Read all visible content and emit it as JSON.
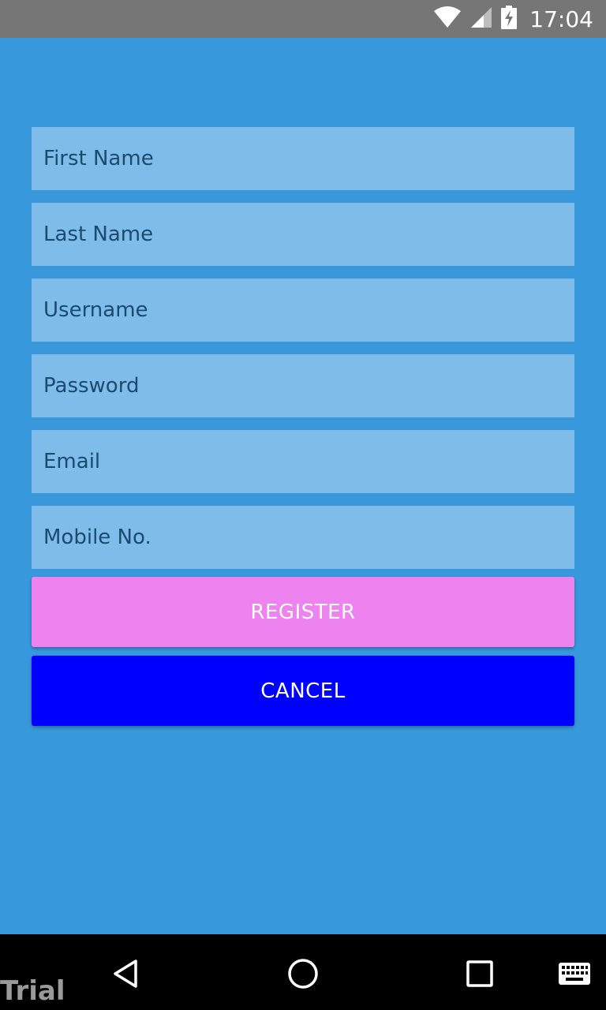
{
  "status_bar": {
    "time": "17:04",
    "icons": [
      "wifi-icon",
      "cell-signal-icon",
      "battery-charging-icon"
    ]
  },
  "form": {
    "first_name": {
      "placeholder": "First Name",
      "value": ""
    },
    "last_name": {
      "placeholder": "Last Name",
      "value": ""
    },
    "username": {
      "placeholder": "Username",
      "value": ""
    },
    "password": {
      "placeholder": "Password",
      "value": ""
    },
    "email": {
      "placeholder": "Email",
      "value": ""
    },
    "mobile": {
      "placeholder": "Mobile No.",
      "value": ""
    }
  },
  "buttons": {
    "register_label": "REGISTER",
    "cancel_label": "CANCEL"
  },
  "nav_bar": {
    "icons": [
      "back-icon",
      "home-icon",
      "recent-apps-icon",
      "keyboard-icon"
    ]
  },
  "watermark": "Trial",
  "colors": {
    "background": "#3898DC",
    "field_background": "#7EBCE9",
    "register_button": "#EE82EE",
    "cancel_button": "#0000FF",
    "status_bar": "#767676",
    "nav_bar": "#000000"
  }
}
